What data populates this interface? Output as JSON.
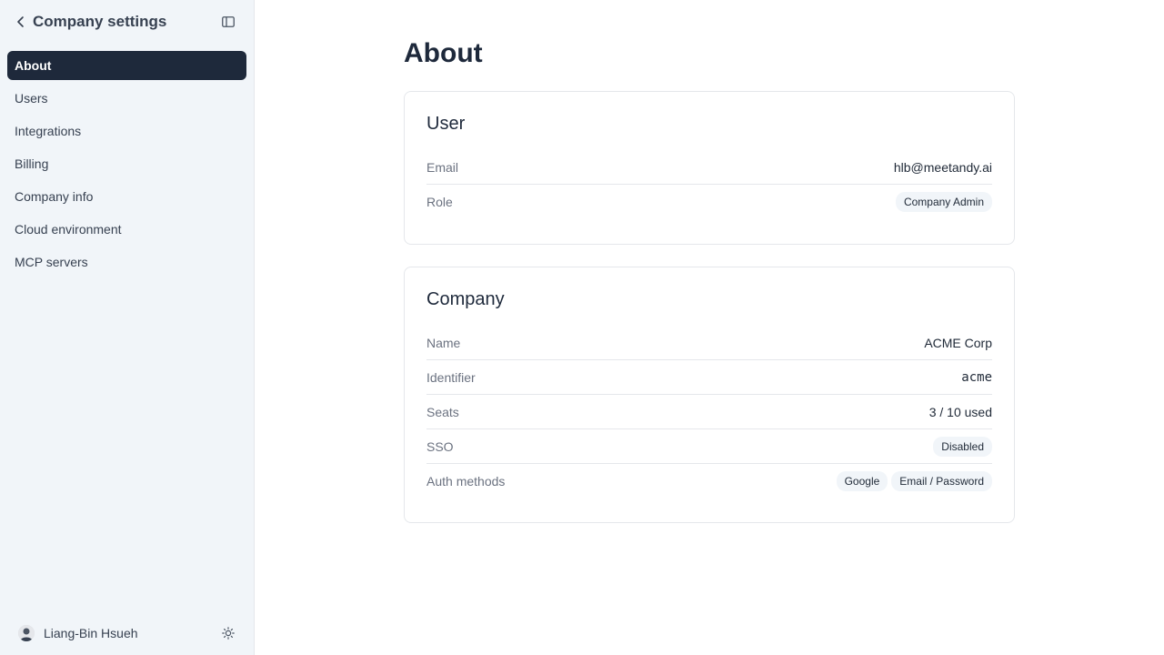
{
  "sidebar": {
    "title": "Company settings",
    "items": [
      {
        "label": "About",
        "active": true
      },
      {
        "label": "Users"
      },
      {
        "label": "Integrations"
      },
      {
        "label": "Billing"
      },
      {
        "label": "Company info"
      },
      {
        "label": "Cloud environment"
      },
      {
        "label": "MCP servers"
      }
    ],
    "user_name": "Liang-Bin Hsueh",
    "icons": {
      "back": "chevron-left-icon",
      "collapse": "sidebar-collapse-icon",
      "theme": "sun-icon"
    }
  },
  "page": {
    "title": "About"
  },
  "user_card": {
    "title": "User",
    "email_label": "Email",
    "email_value": "hlb@meetandy.ai",
    "role_label": "Role",
    "role_value": "Company Admin"
  },
  "company_card": {
    "title": "Company",
    "name_label": "Name",
    "name_value": "ACME Corp",
    "identifier_label": "Identifier",
    "identifier_value": "acme",
    "seats_label": "Seats",
    "seats_value": "3 / 10 used",
    "sso_label": "SSO",
    "sso_value": "Disabled",
    "auth_label": "Auth methods",
    "auth_methods": [
      "Google",
      "Email / Password"
    ]
  },
  "colors": {
    "active_nav": "#1e293b",
    "sidebar_bg": "#f1f5f9",
    "badge_bg": "#f1f5f9"
  }
}
